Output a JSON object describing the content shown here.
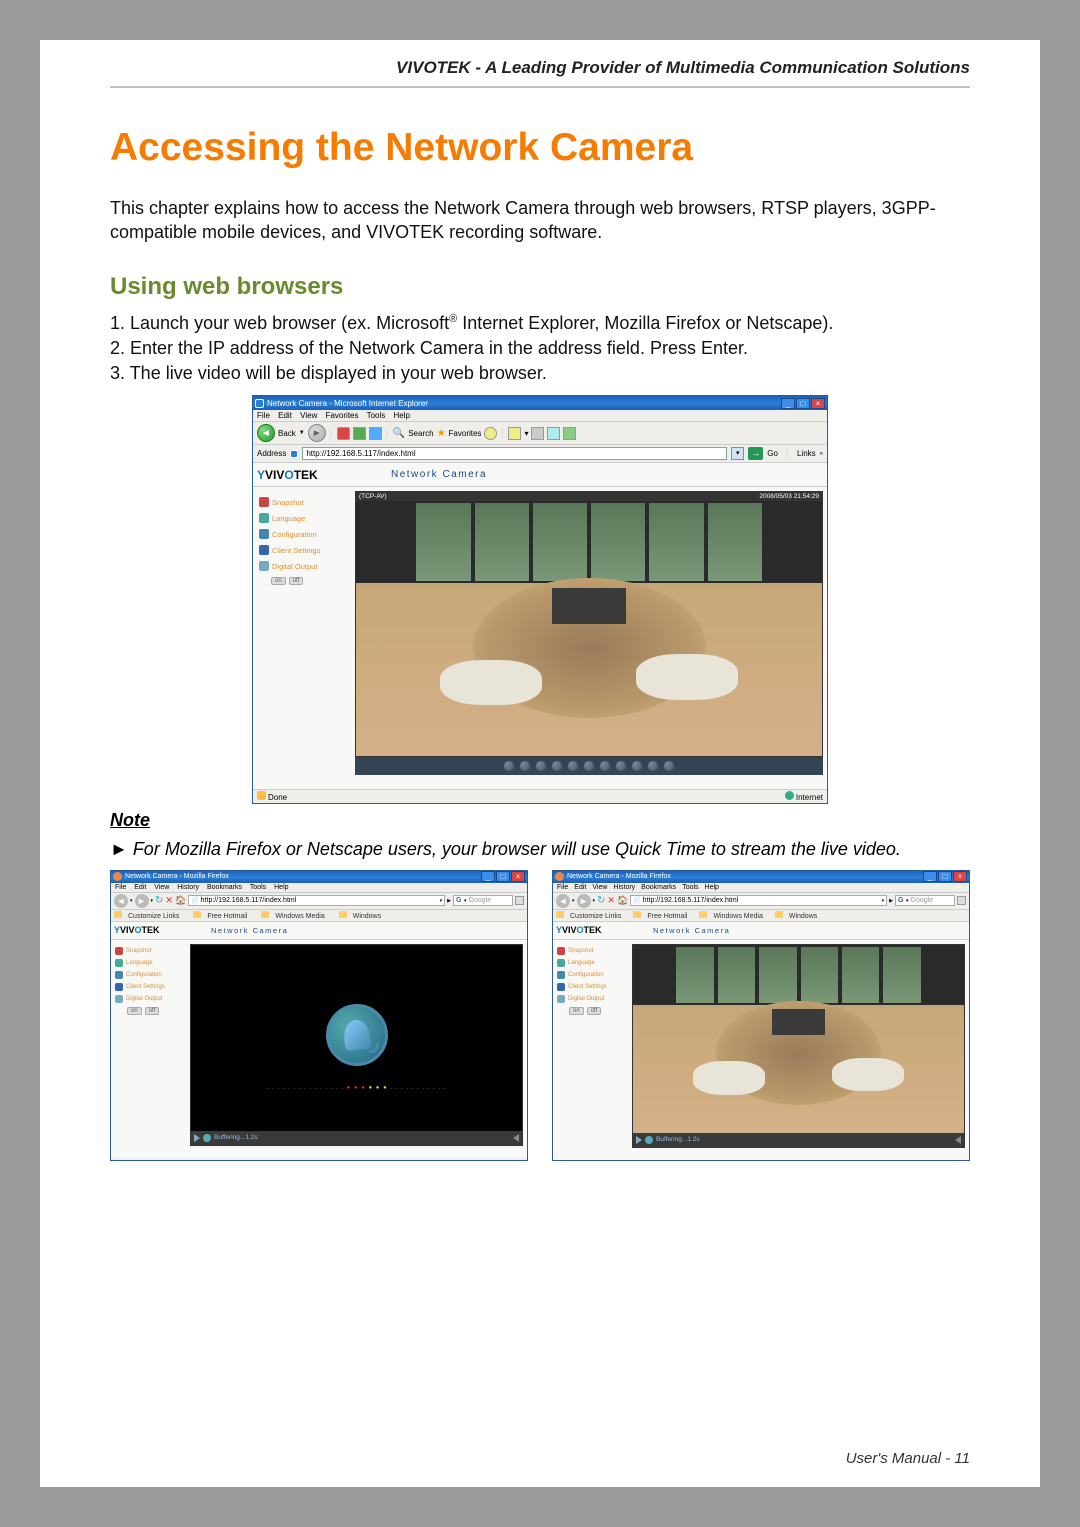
{
  "header": {
    "tagline": "VIVOTEK - A Leading Provider of Multimedia Communication Solutions"
  },
  "title": "Accessing the Network Camera",
  "intro": "This chapter explains how to access the Network Camera through web browsers, RTSP players, 3GPP-compatible mobile devices, and VIVOTEK recording software.",
  "section_heading": "Using web browsers",
  "steps": {
    "s1a": "1. Launch your web browser (ex. Microsoft",
    "s1b": " Internet Explorer, Mozilla Firefox or Netscape).",
    "s2": "2. Enter the IP address of the Network Camera in the address field. Press Enter.",
    "s3": "3. The live video will be displayed in your web browser."
  },
  "note": {
    "heading": "Note",
    "body": "► For Mozilla Firefox or Netscape users, your browser will use Quick Time to stream the live video."
  },
  "ie": {
    "title": "Network Camera - Microsoft Internet Explorer",
    "menu": {
      "file": "File",
      "edit": "Edit",
      "view": "View",
      "fav": "Favorites",
      "tools": "Tools",
      "help": "Help"
    },
    "toolbar": {
      "back": "Back",
      "search": "Search",
      "favorites": "Favorites"
    },
    "addr_label": "Address",
    "url": "http://192.168.5.117/index.html",
    "go": "Go",
    "links": "Links",
    "nc_label": "Network Camera",
    "side": {
      "snapshot": "Snapshot",
      "language": "Language",
      "config": "Configuration",
      "client": "Client Settings",
      "digital": "Digital Output",
      "on": "on",
      "off": "off"
    },
    "video": {
      "left": "(TCP-AV)",
      "right": "2008/05/03 21:54:29"
    },
    "status": {
      "done": "Done",
      "zone": "Internet"
    }
  },
  "ff": {
    "title": "Network Camera - Mozilla Firefox",
    "menu": {
      "file": "File",
      "edit": "Edit",
      "view": "View",
      "history": "History",
      "bookmarks": "Bookmarks",
      "tools": "Tools",
      "help": "Help"
    },
    "url": "http://192.168.5.117/index.html",
    "search_engine": "G",
    "search_ph": "Google",
    "bmk": {
      "cust": "Customize Links",
      "hot": "Free Hotmail",
      "wm": "Windows Media",
      "win": "Windows"
    },
    "nc_label": "Network Camera",
    "side": {
      "snapshot": "Snapshot",
      "language": "Language",
      "config": "Configuration",
      "client": "Client Settings",
      "digital": "Digital Output",
      "on": "on",
      "off": "off"
    },
    "buffering": "Buffering...1.2s"
  },
  "logo": {
    "pre": "VIV",
    "mid": "O",
    "post": "TEK",
    "eye": "Y"
  },
  "footer": "User's Manual - 11"
}
